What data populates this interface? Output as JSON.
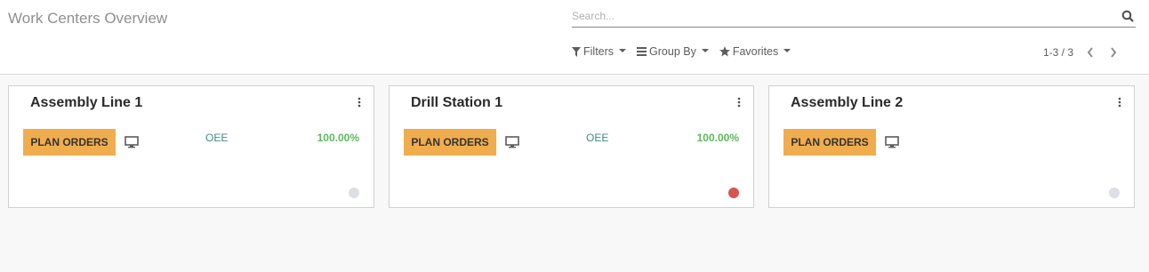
{
  "header": {
    "title": "Work Centers Overview",
    "search_placeholder": "Search..."
  },
  "toolbar": {
    "filters_label": "Filters",
    "group_by_label": "Group By",
    "favorites_label": "Favorites",
    "pager": "1-3 / 3"
  },
  "cards": [
    {
      "name": "Assembly Line 1",
      "button": "PLAN ORDERS",
      "oee_label": "OEE",
      "oee_value": "100.00%",
      "status": "gray"
    },
    {
      "name": "Drill Station 1",
      "button": "PLAN ORDERS",
      "oee_label": "OEE",
      "oee_value": "100.00%",
      "status": "red"
    },
    {
      "name": "Assembly Line 2",
      "button": "PLAN ORDERS",
      "oee_label": "",
      "oee_value": "",
      "status": "gray"
    }
  ],
  "colors": {
    "accent_orange": "#f0ad4e",
    "status_gray": "#dcdfe3",
    "status_red": "#d9534f",
    "oee_green": "#5cb85c"
  }
}
